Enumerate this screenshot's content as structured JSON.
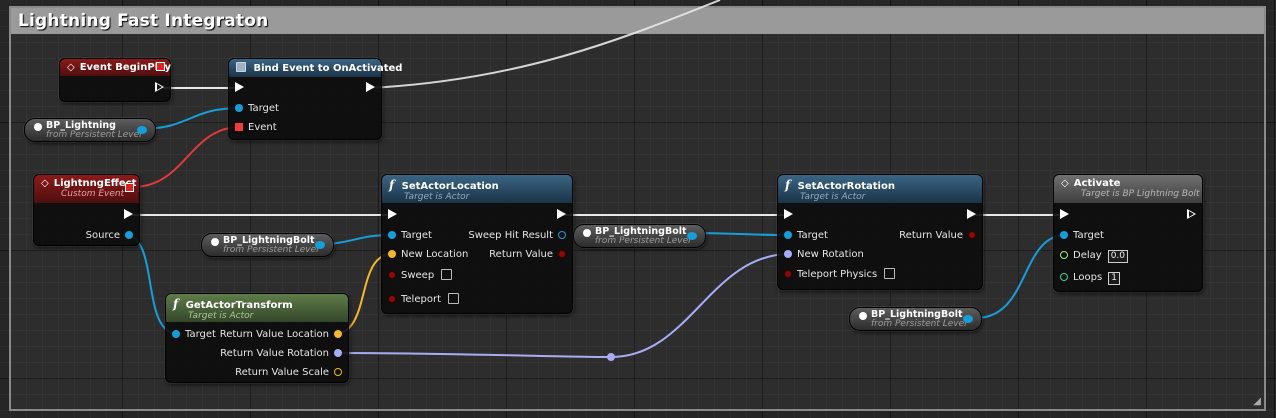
{
  "comment": {
    "title": "Lightning Fast Integraton"
  },
  "nodes": {
    "event_beginplay": {
      "title": "Event BeginPlay"
    },
    "bind_event": {
      "title": "Bind Event to OnActivated",
      "pin_target": "Target",
      "pin_event": "Event"
    },
    "bp_lightning": {
      "name": "BP_Lightning",
      "subtitle": "from Persistent Level"
    },
    "custom_event": {
      "title": "LightnngEffect",
      "subtitle": "Custom Event",
      "pin_source": "Source"
    },
    "bp_bolt_1": {
      "name": "BP_LightningBolt",
      "subtitle": "from Persistent Level"
    },
    "set_location": {
      "title": "SetActorLocation",
      "subtitle": "Target is Actor",
      "pin_target": "Target",
      "pin_new_location": "New Location",
      "pin_sweep": "Sweep",
      "pin_teleport": "Teleport",
      "pin_sweep_hit": "Sweep Hit Result",
      "pin_return": "Return Value"
    },
    "get_transform": {
      "title": "GetActorTransform",
      "subtitle": "Target is Actor",
      "pin_target": "Target",
      "pin_loc": "Return Value Location",
      "pin_rot": "Return Value Rotation",
      "pin_scale": "Return Value Scale"
    },
    "bp_bolt_2": {
      "name": "BP_LightningBolt",
      "subtitle": "from Persistent Level"
    },
    "set_rotation": {
      "title": "SetActorRotation",
      "subtitle": "Target is Actor",
      "pin_target": "Target",
      "pin_new_rotation": "New Rotation",
      "pin_teleport": "Teleport Physics",
      "pin_return": "Return Value"
    },
    "bp_bolt_3": {
      "name": "BP_LightningBolt",
      "subtitle": "from Persistent Level"
    },
    "activate": {
      "title": "Activate",
      "subtitle": "Target is BP Lightning Bolt",
      "pin_target": "Target",
      "pin_delay": "Delay",
      "delay_value": "0.0",
      "pin_loops": "Loops",
      "loops_value": "1"
    }
  },
  "colors": {
    "exec_wire": "#e8e8e8",
    "object_wire": "#169ed9",
    "vector_wire": "#f3b62c",
    "rotator_wire": "#a7acf5",
    "delegate_wire": "#e23a3a"
  }
}
